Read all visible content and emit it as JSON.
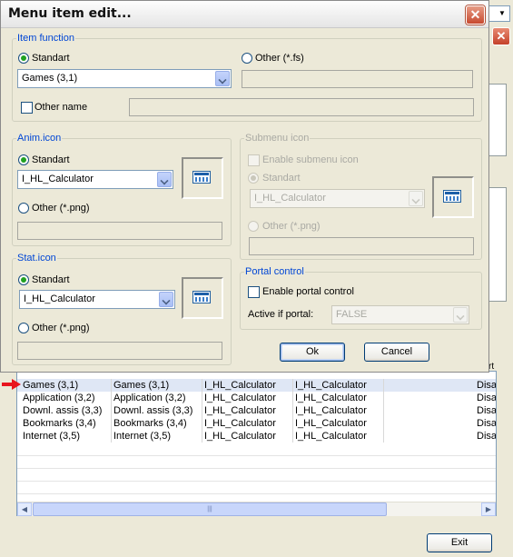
{
  "dialog": {
    "title": "Menu item edit...",
    "item_function": {
      "legend": "Item function",
      "standart_label": "Standart",
      "standart_selected": true,
      "standart_value": "Games (3,1)",
      "other_label": "Other  (*.fs)",
      "other_value": "",
      "other_name_label": "Other name",
      "other_name_value": ""
    },
    "anim_icon": {
      "legend": "Anim.icon",
      "standart_label": "Standart",
      "standart_value": "I_HL_Calculator",
      "other_label": "Other  (*.png)",
      "other_value": "",
      "icon": "calculator-icon"
    },
    "submenu_icon": {
      "legend": "Submenu icon",
      "enable_label": "Enable submenu icon",
      "standart_label": "Standart",
      "standart_value": "I_HL_Calculator",
      "other_label": "Other  (*.png)",
      "other_value": "",
      "icon": "calculator-icon"
    },
    "stat_icon": {
      "legend": "Stat.icon",
      "standart_label": "Standart",
      "standart_value": "I_HL_Calculator",
      "other_label": "Other  (*.png)",
      "other_value": "",
      "icon": "calculator-icon"
    },
    "portal_control": {
      "legend": "Portal control",
      "enable_label": "Enable portal control",
      "active_label": "Active if portal:",
      "active_value": "FALSE"
    },
    "ok_label": "Ok",
    "cancel_label": "Cancel"
  },
  "background": {
    "rows": [
      {
        "c1": "Games (3,1)",
        "c2": "Games (3,1)",
        "c3": "I_HL_Calculator",
        "c4": "I_HL_Calculator",
        "c5": "Disal"
      },
      {
        "c1": "Application (3,2)",
        "c2": "Application (3,2)",
        "c3": "I_HL_Calculator",
        "c4": "I_HL_Calculator",
        "c5": "Disal"
      },
      {
        "c1": "Downl. assis (3,3)",
        "c2": "Downl. assis (3,3)",
        "c3": "I_HL_Calculator",
        "c4": "I_HL_Calculator",
        "c5": "Disal"
      },
      {
        "c1": "Bookmarks (3,4)",
        "c2": "Bookmarks (3,4)",
        "c3": "I_HL_Calculator",
        "c4": "I_HL_Calculator",
        "c5": "Disal"
      },
      {
        "c1": "Internet (3,5)",
        "c2": "Internet (3,5)",
        "c3": "I_HL_Calculator",
        "c4": "I_HL_Calculator",
        "c5": "Disal"
      }
    ],
    "partial_header": "rt",
    "exit_label": "Exit",
    "selected_row_marker_color": "#e8141e"
  }
}
